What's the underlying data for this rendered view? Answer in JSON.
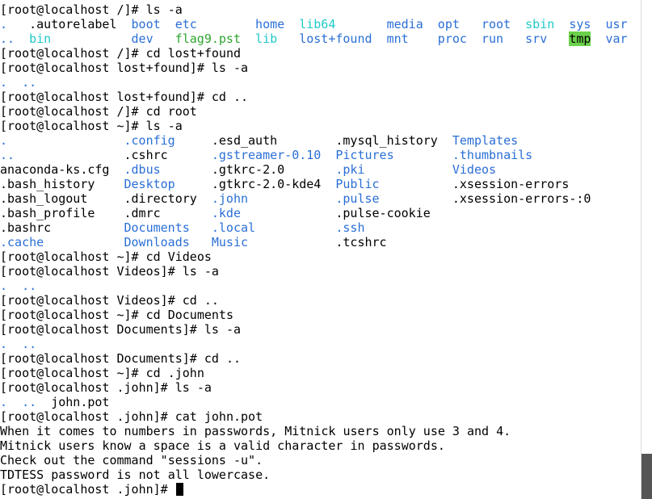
{
  "terminal": {
    "lines": [
      {
        "segs": [
          {
            "t": "[root@localhost /]# ls -a",
            "c": "default",
            "col": 0
          }
        ]
      },
      {
        "segs": [
          {
            "t": ".",
            "c": "blue",
            "col": 0
          },
          {
            "t": ".autorelabel",
            "c": "default",
            "col": 4
          },
          {
            "t": "boot",
            "c": "blue",
            "col": 18
          },
          {
            "t": "etc",
            "c": "blue",
            "col": 24
          },
          {
            "t": "home",
            "c": "blue",
            "col": 35
          },
          {
            "t": "lib64",
            "c": "cyan",
            "col": 41
          },
          {
            "t": "media",
            "c": "blue",
            "col": 53
          },
          {
            "t": "opt",
            "c": "blue",
            "col": 60
          },
          {
            "t": "root",
            "c": "blue",
            "col": 66
          },
          {
            "t": "sbin",
            "c": "cyan",
            "col": 72
          },
          {
            "t": "sys",
            "c": "blue",
            "col": 78
          },
          {
            "t": "usr",
            "c": "blue",
            "col": 83
          }
        ]
      },
      {
        "segs": [
          {
            "t": "..",
            "c": "blue",
            "col": 0
          },
          {
            "t": "bin",
            "c": "cyan",
            "col": 4
          },
          {
            "t": "dev",
            "c": "blue",
            "col": 18
          },
          {
            "t": "flag9.pst",
            "c": "green",
            "col": 24
          },
          {
            "t": "lib",
            "c": "cyan",
            "col": 35
          },
          {
            "t": "lost+found",
            "c": "blue",
            "col": 41
          },
          {
            "t": "mnt",
            "c": "blue",
            "col": 53
          },
          {
            "t": "proc",
            "c": "blue",
            "col": 60
          },
          {
            "t": "run",
            "c": "blue",
            "col": 66
          },
          {
            "t": "srv",
            "c": "blue",
            "col": 72
          },
          {
            "t": "tmp",
            "c": "hl-green",
            "col": 78
          },
          {
            "t": "var",
            "c": "blue",
            "col": 83
          }
        ]
      },
      {
        "segs": [
          {
            "t": "[root@localhost /]# cd lost+found",
            "c": "default",
            "col": 0
          }
        ]
      },
      {
        "segs": [
          {
            "t": "[root@localhost lost+found]# ls -a",
            "c": "default",
            "col": 0
          }
        ]
      },
      {
        "segs": [
          {
            "t": ".",
            "c": "blue",
            "col": 0
          },
          {
            "t": "..",
            "c": "blue",
            "col": 3
          }
        ]
      },
      {
        "segs": [
          {
            "t": "[root@localhost lost+found]# cd ..",
            "c": "default",
            "col": 0
          }
        ]
      },
      {
        "segs": [
          {
            "t": "[root@localhost /]# cd root",
            "c": "default",
            "col": 0
          }
        ]
      },
      {
        "segs": [
          {
            "t": "[root@localhost ~]# ls -a",
            "c": "default",
            "col": 0
          }
        ]
      },
      {
        "segs": [
          {
            "t": ".",
            "c": "blue",
            "col": 0
          },
          {
            "t": ".config",
            "c": "blue",
            "col": 17
          },
          {
            "t": ".esd_auth",
            "c": "default",
            "col": 29
          },
          {
            "t": ".mysql_history",
            "c": "default",
            "col": 46
          },
          {
            "t": "Templates",
            "c": "blue",
            "col": 62
          }
        ]
      },
      {
        "segs": [
          {
            "t": "..",
            "c": "blue",
            "col": 0
          },
          {
            "t": ".cshrc",
            "c": "default",
            "col": 17
          },
          {
            "t": ".gstreamer-0.10",
            "c": "blue",
            "col": 29
          },
          {
            "t": "Pictures",
            "c": "blue",
            "col": 46
          },
          {
            "t": ".thumbnails",
            "c": "blue",
            "col": 62
          }
        ]
      },
      {
        "segs": [
          {
            "t": "anaconda-ks.cfg",
            "c": "default",
            "col": 0
          },
          {
            "t": ".dbus",
            "c": "blue",
            "col": 17
          },
          {
            "t": ".gtkrc-2.0",
            "c": "default",
            "col": 29
          },
          {
            "t": ".pki",
            "c": "blue",
            "col": 46
          },
          {
            "t": "Videos",
            "c": "blue",
            "col": 62
          }
        ]
      },
      {
        "segs": [
          {
            "t": ".bash_history",
            "c": "default",
            "col": 0
          },
          {
            "t": "Desktop",
            "c": "blue",
            "col": 17
          },
          {
            "t": ".gtkrc-2.0-kde4",
            "c": "default",
            "col": 29
          },
          {
            "t": "Public",
            "c": "blue",
            "col": 46
          },
          {
            "t": ".xsession-errors",
            "c": "default",
            "col": 62
          }
        ]
      },
      {
        "segs": [
          {
            "t": ".bash_logout",
            "c": "default",
            "col": 0
          },
          {
            "t": ".directory",
            "c": "default",
            "col": 17
          },
          {
            "t": ".john",
            "c": "blue",
            "col": 29
          },
          {
            "t": ".pulse",
            "c": "blue",
            "col": 46
          },
          {
            "t": ".xsession-errors-:0",
            "c": "default",
            "col": 62
          }
        ]
      },
      {
        "segs": [
          {
            "t": ".bash_profile",
            "c": "default",
            "col": 0
          },
          {
            "t": ".dmrc",
            "c": "default",
            "col": 17
          },
          {
            "t": ".kde",
            "c": "blue",
            "col": 29
          },
          {
            "t": ".pulse-cookie",
            "c": "default",
            "col": 46
          }
        ]
      },
      {
        "segs": [
          {
            "t": ".bashrc",
            "c": "default",
            "col": 0
          },
          {
            "t": "Documents",
            "c": "blue",
            "col": 17
          },
          {
            "t": ".local",
            "c": "blue",
            "col": 29
          },
          {
            "t": ".ssh",
            "c": "blue",
            "col": 46
          }
        ]
      },
      {
        "segs": [
          {
            "t": ".cache",
            "c": "blue",
            "col": 0
          },
          {
            "t": "Downloads",
            "c": "blue",
            "col": 17
          },
          {
            "t": "Music",
            "c": "blue",
            "col": 29
          },
          {
            "t": ".tcshrc",
            "c": "default",
            "col": 46
          }
        ]
      },
      {
        "segs": [
          {
            "t": "[root@localhost ~]# cd Videos",
            "c": "default",
            "col": 0
          }
        ]
      },
      {
        "segs": [
          {
            "t": "[root@localhost Videos]# ls -a",
            "c": "default",
            "col": 0
          }
        ]
      },
      {
        "segs": [
          {
            "t": ".",
            "c": "blue",
            "col": 0
          },
          {
            "t": "..",
            "c": "blue",
            "col": 3
          }
        ]
      },
      {
        "segs": [
          {
            "t": "[root@localhost Videos]# cd ..",
            "c": "default",
            "col": 0
          }
        ]
      },
      {
        "segs": [
          {
            "t": "[root@localhost ~]# cd Documents",
            "c": "default",
            "col": 0
          }
        ]
      },
      {
        "segs": [
          {
            "t": "[root@localhost Documents]# ls -a",
            "c": "default",
            "col": 0
          }
        ]
      },
      {
        "segs": [
          {
            "t": ".",
            "c": "blue",
            "col": 0
          },
          {
            "t": "..",
            "c": "blue",
            "col": 3
          }
        ]
      },
      {
        "segs": [
          {
            "t": "[root@localhost Documents]# cd ..",
            "c": "default",
            "col": 0
          }
        ]
      },
      {
        "segs": [
          {
            "t": "[root@localhost ~]# cd .john",
            "c": "default",
            "col": 0
          }
        ]
      },
      {
        "segs": [
          {
            "t": "[root@localhost .john]# ls -a",
            "c": "default",
            "col": 0
          }
        ]
      },
      {
        "segs": [
          {
            "t": ".",
            "c": "blue",
            "col": 0
          },
          {
            "t": "..",
            "c": "blue",
            "col": 3
          },
          {
            "t": "john.pot",
            "c": "default",
            "col": 7
          }
        ]
      },
      {
        "segs": [
          {
            "t": "[root@localhost .john]# cat john.pot",
            "c": "default",
            "col": 0
          }
        ]
      },
      {
        "segs": [
          {
            "t": "When it comes to numbers in passwords, Mitnick users only use 3 and 4.",
            "c": "default",
            "col": 0
          }
        ]
      },
      {
        "segs": [
          {
            "t": "Mitnick users know a space is a valid character in passwords.",
            "c": "default",
            "col": 0
          }
        ]
      },
      {
        "segs": [
          {
            "t": "Check out the command \"sessions -u\".",
            "c": "default",
            "col": 0
          }
        ]
      },
      {
        "segs": [
          {
            "t": "TDTESS password is not all lowercase.",
            "c": "default",
            "col": 0
          }
        ]
      },
      {
        "segs": [
          {
            "t": "[root@localhost .john]# ",
            "c": "default",
            "col": 0
          }
        ],
        "cursor_col": 24
      }
    ]
  },
  "scrollbar": {
    "thumb_fraction_start": 0.91,
    "thumb_fraction_size": 0.09
  }
}
